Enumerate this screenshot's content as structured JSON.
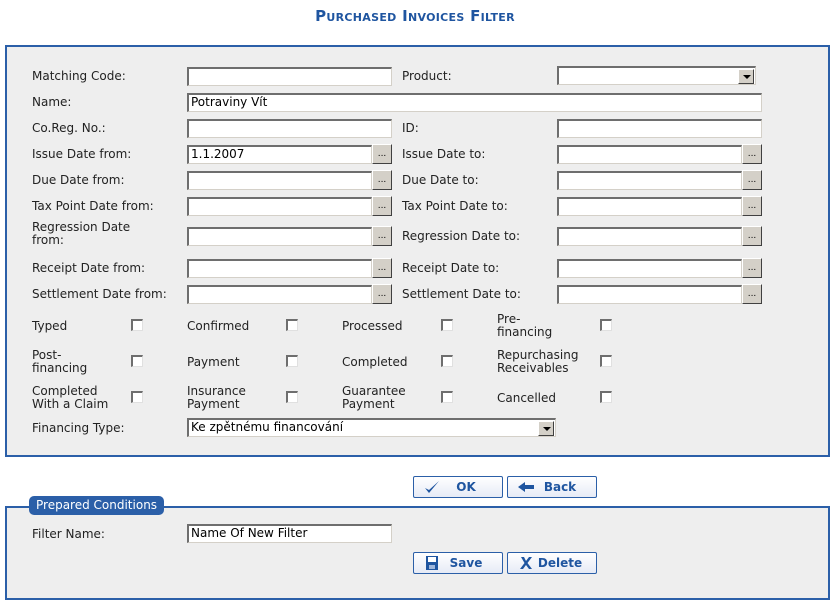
{
  "title": "Purchased Invoices Filter",
  "fields": {
    "matching_code": {
      "label": "Matching Code:",
      "value": ""
    },
    "product": {
      "label": "Product:",
      "value": ""
    },
    "name": {
      "label": "Name:",
      "value": "Potraviny Vít"
    },
    "coreg": {
      "label": "Co.Reg. No.:",
      "value": ""
    },
    "id": {
      "label": "ID:",
      "value": ""
    }
  },
  "date_rows": [
    {
      "from_label": "Issue Date from:",
      "from_value": "1.1.2007",
      "to_label": "Issue Date to:",
      "to_value": ""
    },
    {
      "from_label": "Due Date from:",
      "from_value": "",
      "to_label": "Due Date to:",
      "to_value": ""
    },
    {
      "from_label": "Tax Point Date from:",
      "from_value": "",
      "to_label": "Tax Point Date to:",
      "to_value": ""
    },
    {
      "from_label": "Regression Date from:",
      "from_value": "",
      "to_label": "Regression Date to:",
      "to_value": ""
    },
    {
      "from_label": "Receipt Date from:",
      "from_value": "",
      "to_label": "Receipt Date to:",
      "to_value": ""
    },
    {
      "from_label": "Settlement Date from:",
      "from_value": "",
      "to_label": "Settlement Date to:",
      "to_value": ""
    }
  ],
  "picker_label": "...",
  "checkboxes": [
    {
      "label": "Typed",
      "checked": false
    },
    {
      "label": "Confirmed",
      "checked": false
    },
    {
      "label": "Processed",
      "checked": false
    },
    {
      "label": "Pre-financing",
      "checked": false
    },
    {
      "label": "Post-financing",
      "checked": false
    },
    {
      "label": "Payment",
      "checked": false
    },
    {
      "label": "Completed",
      "checked": false
    },
    {
      "label": "Repurchasing Receivables",
      "checked": false
    },
    {
      "label": "Completed With a Claim",
      "checked": false
    },
    {
      "label": "Insurance Payment",
      "checked": false
    },
    {
      "label": "Guarantee Payment",
      "checked": false
    },
    {
      "label": "Cancelled",
      "checked": false
    }
  ],
  "financing_type": {
    "label": "Financing Type:",
    "value": "Ke zpětnému financování"
  },
  "buttons": {
    "ok": "OK",
    "back": "Back",
    "save": "Save",
    "delete": "Delete"
  },
  "prepared": {
    "legend": "Prepared Conditions",
    "filter_name_label": "Filter Name:",
    "filter_name_value": "Name Of New Filter"
  },
  "colors": {
    "accent": "#2b5fa8",
    "panel_bg": "#eeeeee",
    "title": "#1f55a0"
  }
}
